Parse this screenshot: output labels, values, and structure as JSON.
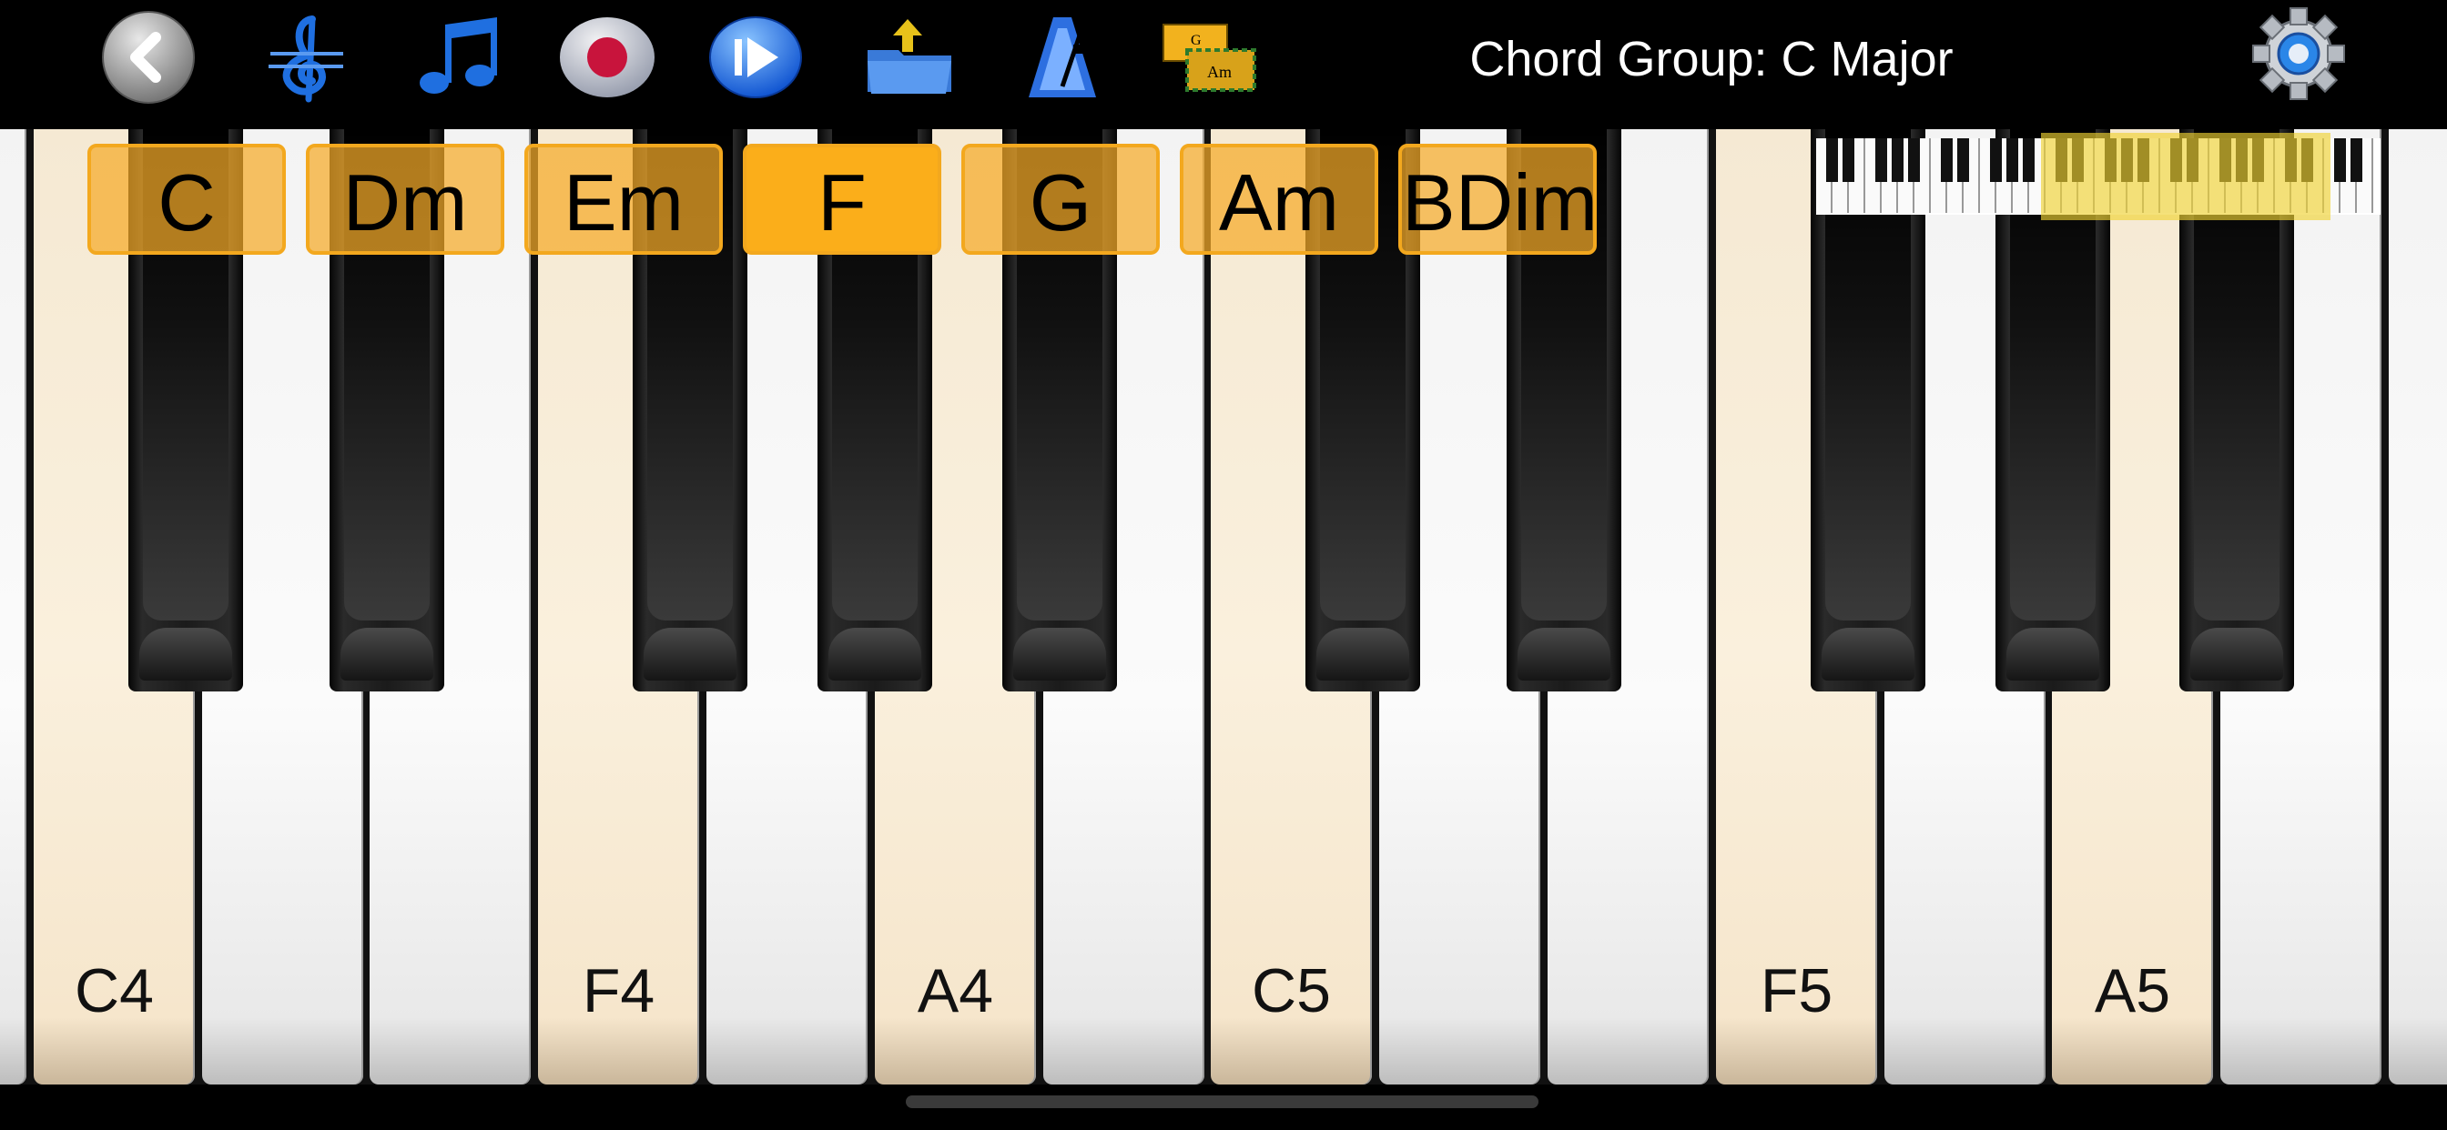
{
  "toolbar": {
    "title": "Chord Group: C Major",
    "buttons": [
      {
        "name": "back-button",
        "icon": "back-arrow-icon"
      },
      {
        "name": "clef-button",
        "icon": "treble-clef-icon"
      },
      {
        "name": "notes-button",
        "icon": "music-notes-icon"
      },
      {
        "name": "record-button",
        "icon": "record-icon"
      },
      {
        "name": "play-button",
        "icon": "play-icon"
      },
      {
        "name": "open-folder-button",
        "icon": "folder-icon"
      },
      {
        "name": "metronome-button",
        "icon": "metronome-icon"
      },
      {
        "name": "chord-cards-button",
        "icon": "chord-cards-icon",
        "label_top": "G",
        "label_bottom": "Am"
      },
      {
        "name": "settings-button",
        "icon": "gear-icon"
      }
    ]
  },
  "chords": [
    "C",
    "Dm",
    "Em",
    "F",
    "G",
    "Am",
    "BDim"
  ],
  "active_chord": "F",
  "keyboard": {
    "white_key_labels": [
      "C4",
      "",
      "",
      "F4",
      "",
      "A4",
      "",
      "C5",
      "",
      "",
      "F5",
      "",
      "A5",
      ""
    ],
    "highlighted_white_keys": [
      "C4",
      "F4",
      "A4",
      "C5",
      "F5",
      "A5"
    ]
  },
  "colors": {
    "accent": "#fbae1a",
    "chord_border": "#f3a81e",
    "highlight_key": "#f6ead5",
    "toolbar_icon_blue": "#1f6fe0"
  }
}
